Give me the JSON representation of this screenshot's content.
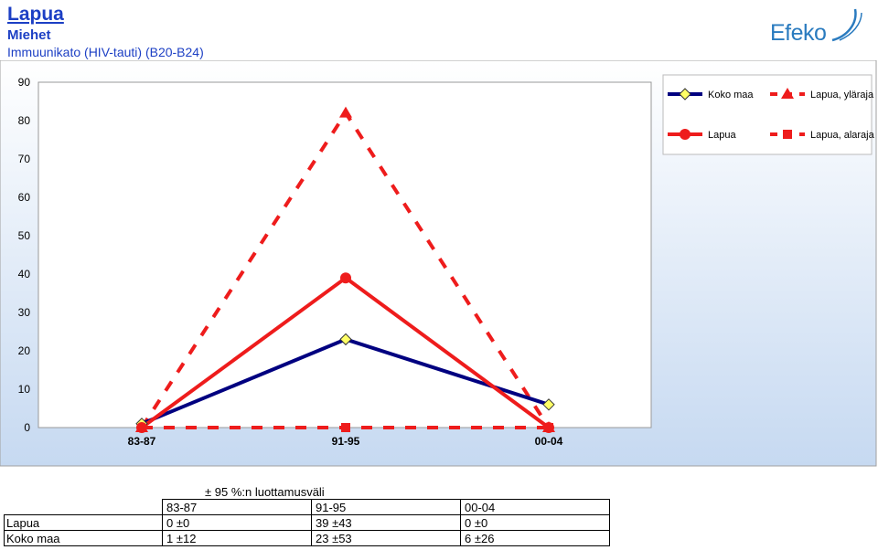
{
  "header": {
    "title": "Lapua",
    "subtitle": "Miehet",
    "description": "Immuunikato (HIV-tauti) (B20-B24)",
    "logo_text": "Efeko"
  },
  "colors": {
    "koko_maa": "#000080",
    "lapua": "#ee1c1c",
    "marker_fill": "#ffff66",
    "plot_bg_top": "#ffffff",
    "plot_bg_bottom": "#c6d9f1"
  },
  "chart_data": {
    "type": "line",
    "categories": [
      "83-87",
      "91-95",
      "00-04"
    ],
    "ylim": [
      0,
      90
    ],
    "yticks": [
      0,
      10,
      20,
      30,
      40,
      50,
      60,
      70,
      80,
      90
    ],
    "legend_position": "top-right",
    "series": [
      {
        "name": "Koko maa",
        "values": [
          1,
          23,
          6
        ],
        "style": "solid",
        "marker": "diamond",
        "color": "#000080"
      },
      {
        "name": "Lapua",
        "values": [
          0,
          39,
          0
        ],
        "style": "solid",
        "marker": "circle",
        "color": "#ee1c1c"
      },
      {
        "name": "Lapua, yläraja",
        "values": [
          0,
          82,
          0
        ],
        "style": "dashed",
        "marker": "triangle",
        "color": "#ee1c1c"
      },
      {
        "name": "Lapua, alaraja",
        "values": [
          0,
          0,
          0
        ],
        "style": "dashed",
        "marker": "square",
        "color": "#ee1c1c"
      }
    ]
  },
  "table": {
    "caption": "± 95 %:n luottamusväli",
    "columns": [
      "83-87",
      "91-95",
      "00-04"
    ],
    "rows": [
      {
        "label": "Lapua",
        "cells": [
          "0 ±0",
          "39 ±43",
          "0 ±0"
        ]
      },
      {
        "label": "Koko maa",
        "cells": [
          "1 ±12",
          "23 ±53",
          "6 ±26"
        ]
      }
    ]
  }
}
